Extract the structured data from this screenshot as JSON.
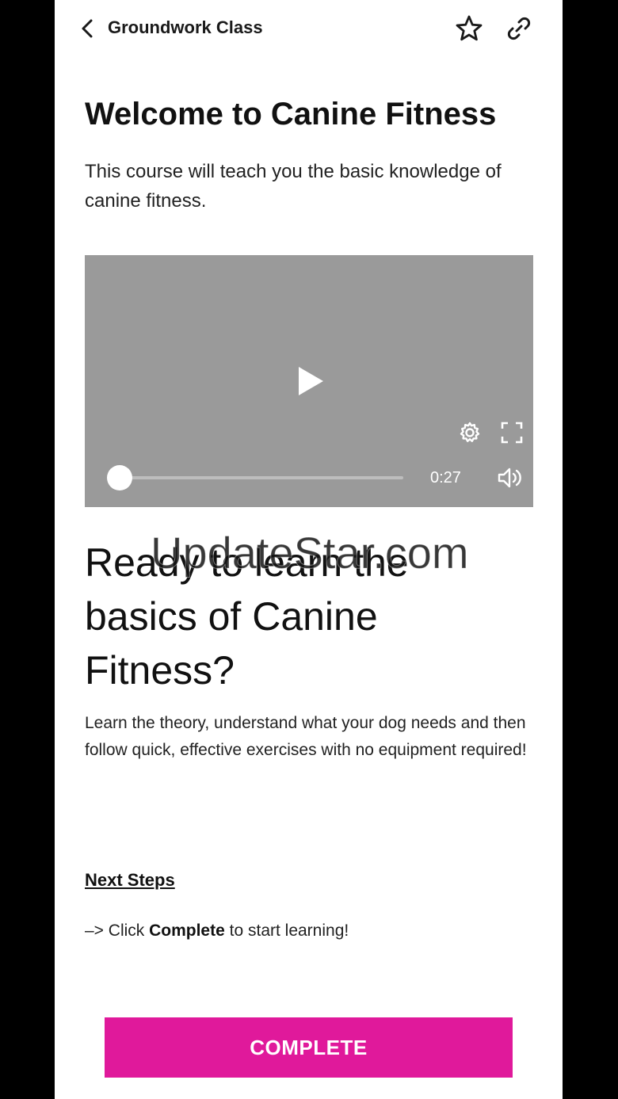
{
  "header": {
    "title": "Groundwork Class",
    "back_icon": "chevron-left-icon",
    "favorite_icon": "star-icon",
    "share_icon": "link-icon"
  },
  "intro": {
    "title": "Welcome to Canine Fitness",
    "description": "This course will teach you the basic knowledge of canine fitness."
  },
  "video": {
    "time": "0:27",
    "progress": 0.0,
    "background_color": "#9a9a9a",
    "icons": [
      "play-icon",
      "settings-icon",
      "fullscreen-icon",
      "volume-icon"
    ]
  },
  "content": {
    "headline": "Ready to learn the basics of Canine Fitness?",
    "body": "Learn the theory, understand what your dog needs and then follow quick, effective exercises with no equipment required!",
    "next_steps_label": "Next Steps",
    "instruction_prefix": "–> Click ",
    "instruction_bold": "Complete",
    "instruction_suffix": " to start learning!"
  },
  "actions": {
    "complete_label": "COMPLETE",
    "accent_color": "#e0199b"
  },
  "watermark": {
    "text": "UpdateStar.com"
  }
}
